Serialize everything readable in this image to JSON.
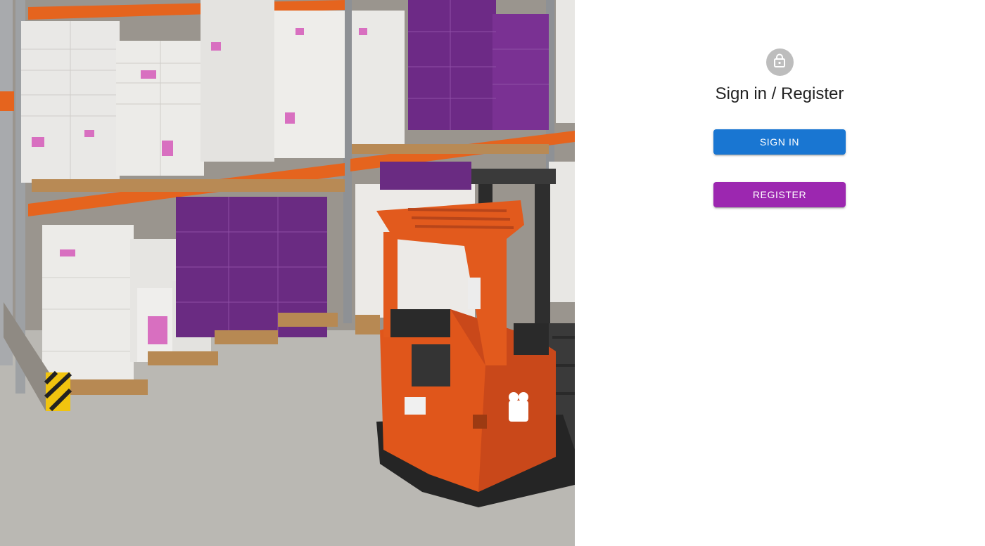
{
  "auth": {
    "title": "Sign in / Register",
    "sign_in_label": "SIGN IN",
    "register_label": "REGISTER",
    "lock_icon": "lock-icon"
  },
  "hero": {
    "description_icon": "warehouse-photo"
  },
  "colors": {
    "sign_in_button": "#1976d2",
    "register_button": "#9c27b0",
    "avatar": "#bdbdbd",
    "title_text": "#222222"
  }
}
